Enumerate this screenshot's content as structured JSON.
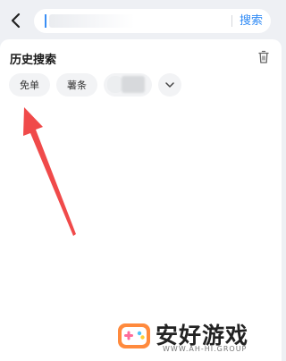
{
  "header": {
    "back_icon": "chevron-left-icon",
    "search_input": {
      "value": "",
      "placeholder": ""
    },
    "search_button": "搜索",
    "accent_color": "#2f8af5"
  },
  "history": {
    "title": "历史搜索",
    "delete_icon": "trash-icon",
    "chips": [
      "免单",
      "薯条"
    ],
    "expand_icon": "chevron-down-icon"
  },
  "annotation": {
    "arrow_color": "#f04a4a"
  },
  "watermark": {
    "text": "安好游戏",
    "url": "WWW.AH-HI.GROUP"
  }
}
